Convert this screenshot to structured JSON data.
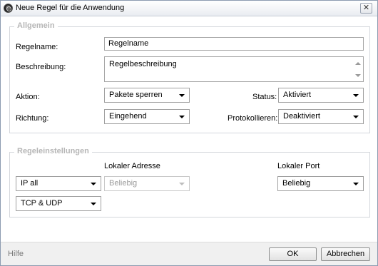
{
  "window": {
    "title": "Neue Regel für die Anwendung",
    "icon": "app-shield-icon",
    "close_glyph": "✕"
  },
  "general": {
    "legend": "Allgemein",
    "rule_name_label": "Regelname:",
    "rule_name_value": "Regelname",
    "description_label": "Beschreibung:",
    "description_value": "Regelbeschreibung",
    "action_label": "Aktion:",
    "action_value": "Pakete sperren",
    "status_label": "Status:",
    "status_value": "Aktiviert",
    "direction_label": "Richtung:",
    "direction_value": "Eingehend",
    "logging_label": "Protokollieren:",
    "logging_value": "Deaktiviert"
  },
  "rule_settings": {
    "legend": "Regeleinstellungen",
    "local_address_label": "Lokaler Adresse",
    "local_port_label": "Lokaler Port",
    "ip_value": "IP all",
    "local_address_value": "Beliebig",
    "local_port_value": "Beliebig",
    "protocol_value": "TCP & UDP"
  },
  "footer": {
    "help_label": "Hilfe",
    "ok_label": "OK",
    "cancel_label": "Abbrechen"
  }
}
